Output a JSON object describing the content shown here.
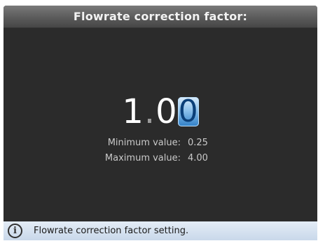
{
  "title": "Flowrate correction factor:",
  "value": {
    "integer_digit": "1",
    "decimal_separator": ".",
    "first_decimal": "0",
    "selected_decimal": "0"
  },
  "limits": {
    "min_label": "Minimum value:",
    "min_value": "0.25",
    "max_label": "Maximum value:",
    "max_value": "4.00"
  },
  "status": {
    "icon": "info-icon",
    "text": "Flowrate correction factor setting."
  },
  "colors": {
    "background": "#2b2b2b",
    "titlebar": "#5b5b5b",
    "cursor_highlight": "#2f7fc7",
    "statusbar": "#c9d8ea"
  }
}
